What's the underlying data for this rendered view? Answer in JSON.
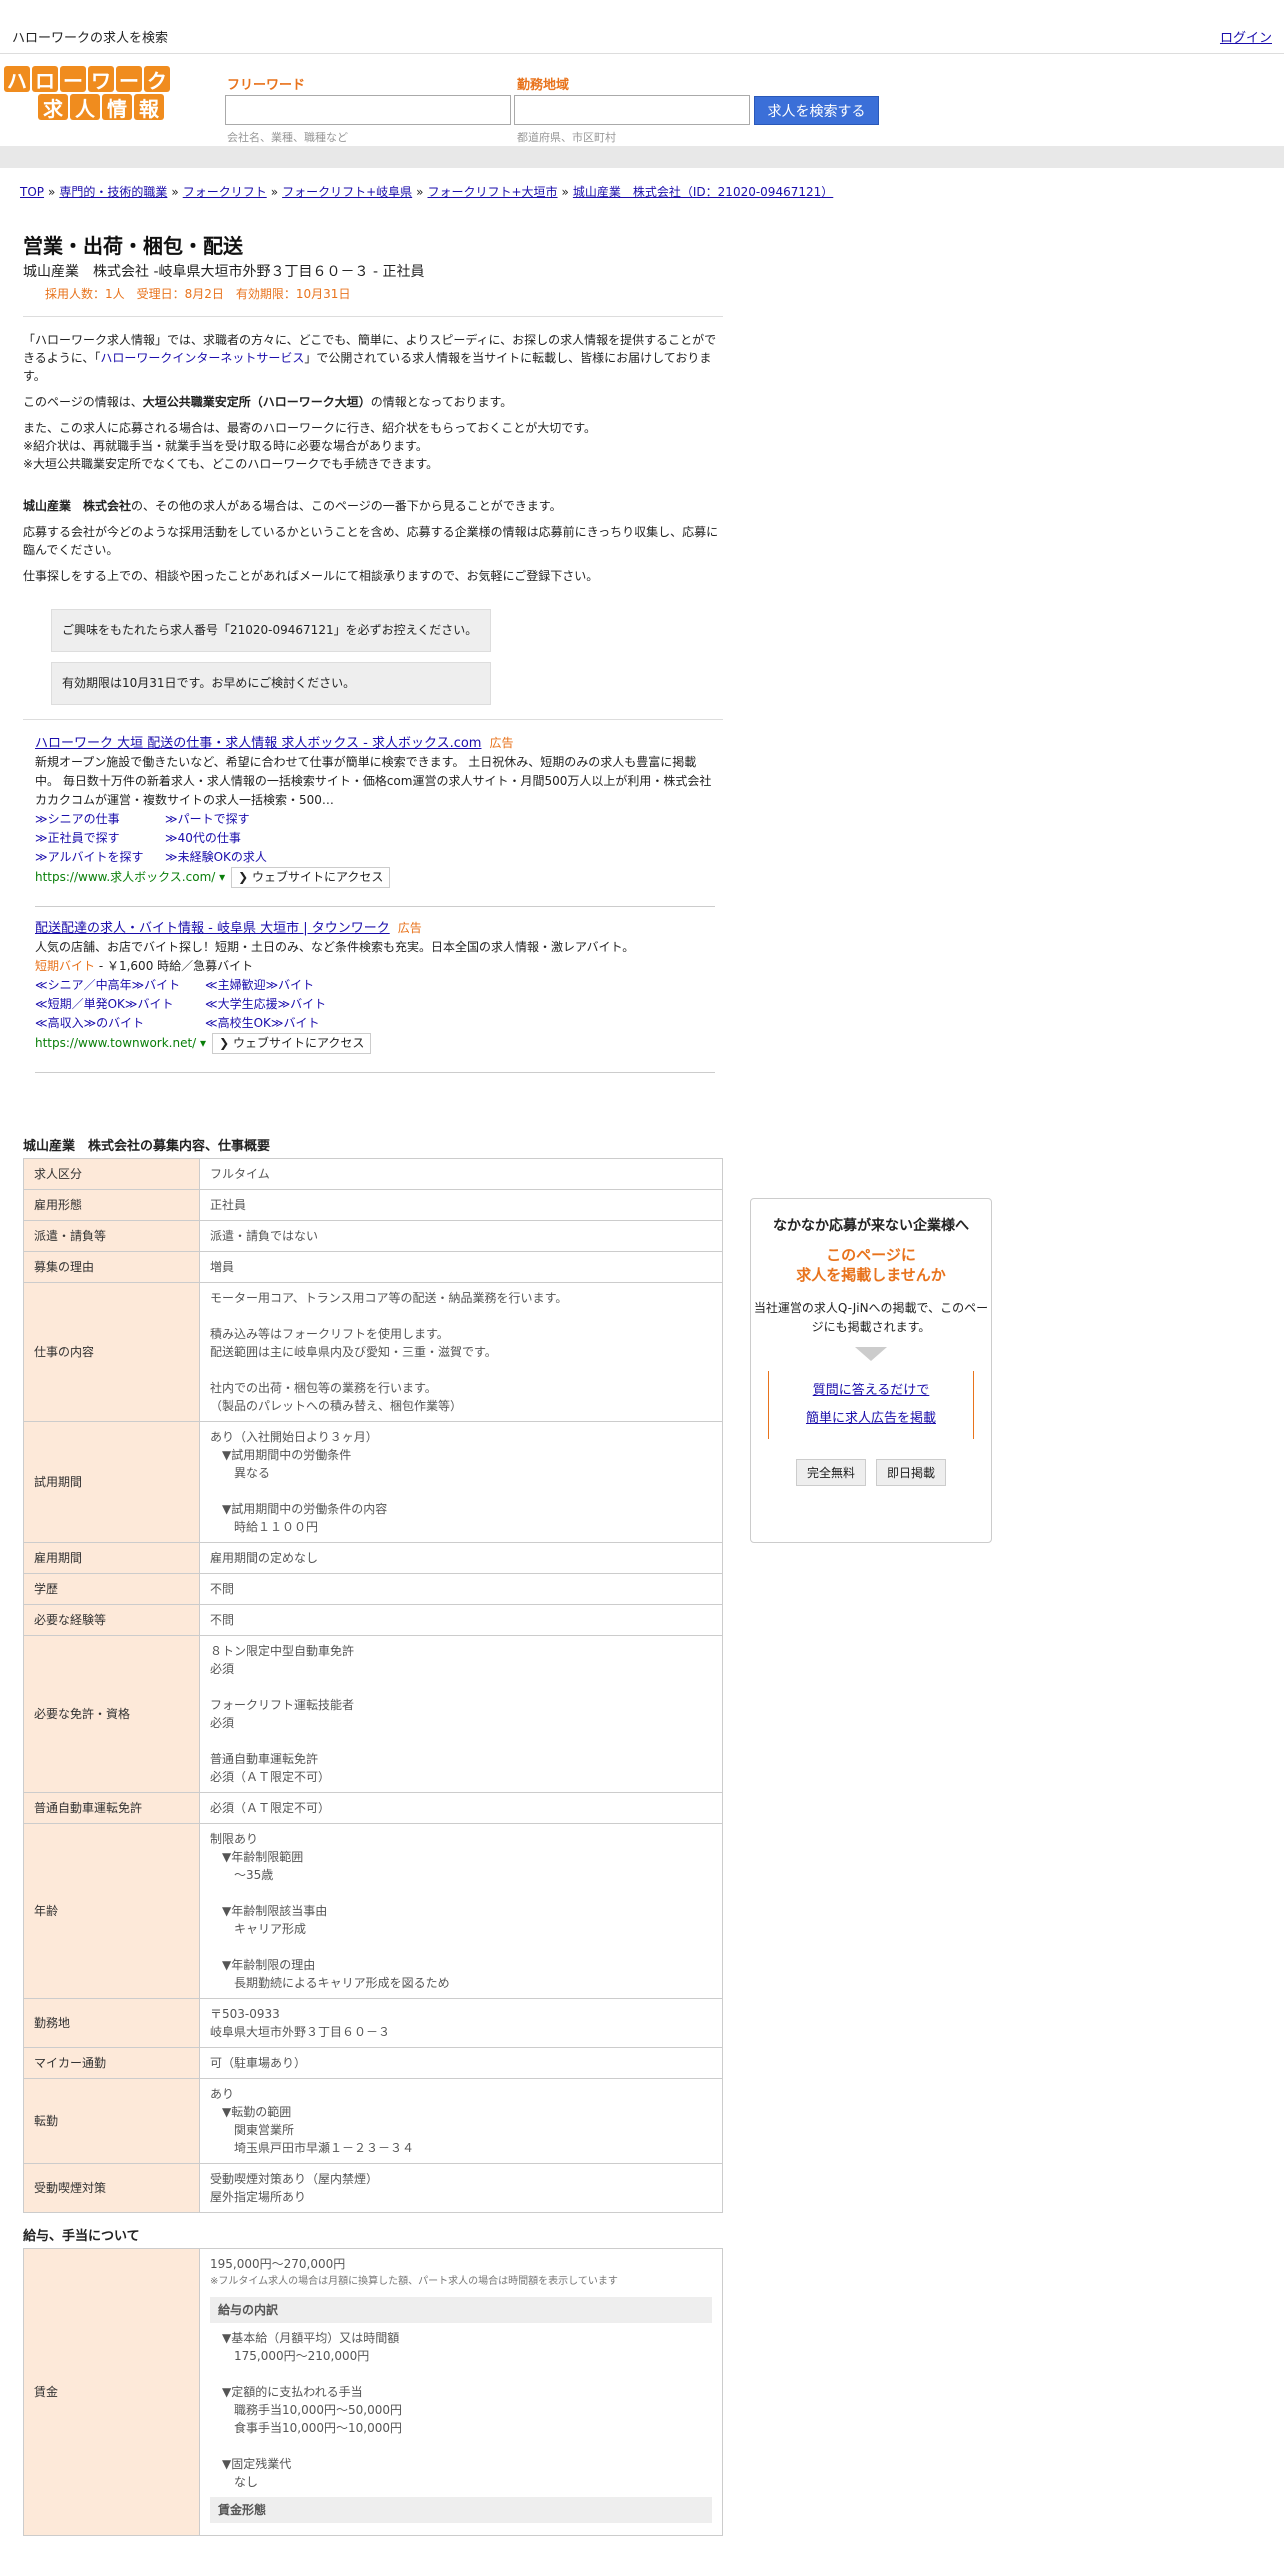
{
  "topbar": {
    "site_title": "ハローワークの求人を検索",
    "login": "ログイン"
  },
  "logo": {
    "row1": [
      "ハ",
      "ロ",
      "ー",
      "ワ",
      "ー",
      "ク"
    ],
    "row2": [
      "求",
      "人",
      "情",
      "報"
    ]
  },
  "search": {
    "freeword_label": "フリーワード",
    "freeword_placeholder": "会社名、業種、職種など",
    "area_label": "勤務地域",
    "area_placeholder": "都道府県、市区町村",
    "button": "求人を検索する"
  },
  "breadcrumb": [
    "TOP",
    "専門的・技術的職業",
    "フォークリフト",
    "フォークリフト+岐阜県",
    "フォークリフト+大垣市",
    "城山産業　株式会社（ID：21020-09467121）"
  ],
  "job": {
    "title": "営業・出荷・梱包・配送",
    "subtitle": "城山産業　株式会社 -岐阜県大垣市外野３丁目６０－３ - 正社員",
    "meta": "採用人数：1人　受理日：8月2日　有効期限：10月31日"
  },
  "notes": {
    "p1a": "「ハローワーク求人情報」では、求職者の方々に、どこでも、簡単に、よりスピーディに、お探しの求人情報を提供することができるように、「",
    "p1link": "ハローワークインターネットサービス",
    "p1b": "」で公開されている求人情報を当サイトに転載し、皆様にお届けしております。",
    "p2a": "このページの情報は、",
    "p2b": "大垣公共職業安定所（ハローワーク大垣）",
    "p2c": "の情報となっております。",
    "p3": "また、この求人に応募される場合は、最寄のハローワークに行き、紹介状をもらっておくことが大切です。",
    "p4": "※紹介状は、再就職手当・就業手当を受け取る時に必要な場合があります。",
    "p5": "※大垣公共職業安定所でなくても、どこのハローワークでも手続きできます。",
    "p6a": "城山産業　株式会社",
    "p6b": "の、その他の求人がある場合は、このページの一番下から見ることができます。",
    "p7": "応募する会社が今どのような採用活動をしているかということを含め、応募する企業様の情報は応募前にきっちり収集し、応募に臨んでください。",
    "p8": "仕事探しをする上での、相談や困ったことがあればメールにて相談承りますので、お気軽にご登録下さい。",
    "box1": "ご興味をもたれたら求人番号「21020-09467121」を必ずお控えください。",
    "box2": "有効期限は10月31日です。お早めにご検討ください。"
  },
  "ads": [
    {
      "title": "ハローワーク 大垣 配送の仕事・求人情報 求人ボックス - 求人ボックス.com",
      "tag": "広告",
      "desc": "新規オープン施設で働きたいなど、希望に合わせて仕事が簡単に検索できます。 土日祝休み、短期のみの求人も豊富に掲載中。 毎日数十万件の新着求人・求人情報の一括検索サイト・価格com運営の求人サイト・月間500万人以上が利用・株式会社カカクコムが運営・複数サイトの求人一括検索・500…",
      "links": [
        "≫シニアの仕事",
        "≫パートで探す",
        "≫正社員で探す",
        "≫40代の仕事",
        "≫アルバイトを探す",
        "≫未経験OKの求人"
      ],
      "url": "https://www.求人ボックス.com/ ▾",
      "visit": "❯ ウェブサイトにアクセス"
    },
    {
      "title": "配送配達の求人・バイト情報 - 岐阜県 大垣市 | タウンワーク",
      "tag": "広告",
      "desc": "人気の店舗、お店でバイト探し！短期・土日のみ、など条件検索も充実。日本全国の求人情報・激レアバイト。",
      "price_a": "短期バイト",
      "price_b": " - ￥1,600 時給／急募バイト",
      "links": [
        "≪シニア／中高年≫バイト",
        "≪主婦歓迎≫バイト",
        "≪短期／単発OK≫バイト",
        "≪大学生応援≫バイト",
        "≪高収入≫のバイト",
        "≪高校生OK≫バイト"
      ],
      "url": "https://www.townwork.net/ ▾",
      "visit": "❯ ウェブサイトにアクセス"
    }
  ],
  "spec_title": "城山産業　株式会社の募集内容、仕事概要",
  "spec": [
    {
      "k": "求人区分",
      "v": "フルタイム"
    },
    {
      "k": "雇用形態",
      "v": "正社員"
    },
    {
      "k": "派遣・請負等",
      "v": "派遣・請負ではない"
    },
    {
      "k": "募集の理由",
      "v": "増員"
    },
    {
      "k": "仕事の内容",
      "v": "モーター用コア、トランス用コア等の配送・納品業務を行います。\n\n積み込み等はフォークリフトを使用します。\n配送範囲は主に岐阜県内及び愛知・三重・滋賀です。\n\n社内での出荷・梱包等の業務を行います。\n（製品のパレットへの積み替え、梱包作業等）"
    },
    {
      "k": "試用期間",
      "v": "あり（入社開始日より３ヶ月）\n　▼試用期間中の労働条件\n　　異なる\n\n　▼試用期間中の労働条件の内容\n　　時給１１００円"
    },
    {
      "k": "雇用期間",
      "v": "雇用期間の定めなし"
    },
    {
      "k": "学歴",
      "v": "不問"
    },
    {
      "k": "必要な経験等",
      "v": "不問"
    },
    {
      "k": "必要な免許・資格",
      "v": "８トン限定中型自動車免許\n必須\n\nフォークリフト運転技能者\n必須\n\n普通自動車運転免許\n必須（ＡＴ限定不可）"
    },
    {
      "k": "普通自動車運転免許",
      "v": "必須（ＡＴ限定不可）"
    },
    {
      "k": "年齢",
      "v": "制限あり\n　▼年齢制限範囲\n　　〜35歳\n\n　▼年齢制限該当事由\n　　キャリア形成\n\n　▼年齢制限の理由\n　　長期勤続によるキャリア形成を図るため"
    },
    {
      "k": "勤務地",
      "v": "〒503-0933\n岐阜県大垣市外野３丁目６０－３"
    },
    {
      "k": "マイカー通勤",
      "v": "可（駐車場あり）"
    },
    {
      "k": "転勤",
      "v": "あり\n　▼転勤の範囲\n　　関東営業所\n　　埼玉県戸田市早瀬１－２３－３４"
    },
    {
      "k": "受動喫煙対策",
      "v": "受動喫煙対策あり（屋内禁煙）\n屋外指定場所あり"
    }
  ],
  "salary_title": "給与、手当について",
  "salary": {
    "k": "賃金",
    "range": "195,000円〜270,000円",
    "note": "※フルタイム求人の場合は月額に換算した額、パート求人の場合は時間額を表示しています",
    "breakdown_head": "給与の内訳",
    "breakdown": "　▼基本給（月額平均）又は時間額\n　　175,000円〜210,000円\n\n　▼定額的に支払われる手当\n　　職務手当10,000円〜50,000円\n　　食事手当10,000円〜10,000円\n\n　▼固定残業代\n　　なし",
    "form_head": "賃金形態"
  },
  "sidebox": {
    "head": "なかなか応募が来ない企業様へ",
    "offer1": "このページに",
    "offer2": "求人を掲載しませんか",
    "desc": "当社運営の求人Q-JiNへの掲載で、このページにも掲載されます。",
    "link1": "質問に答えるだけで",
    "link2": "簡単に求人広告を掲載",
    "btn1": "完全無料",
    "btn2": "即日掲載"
  }
}
